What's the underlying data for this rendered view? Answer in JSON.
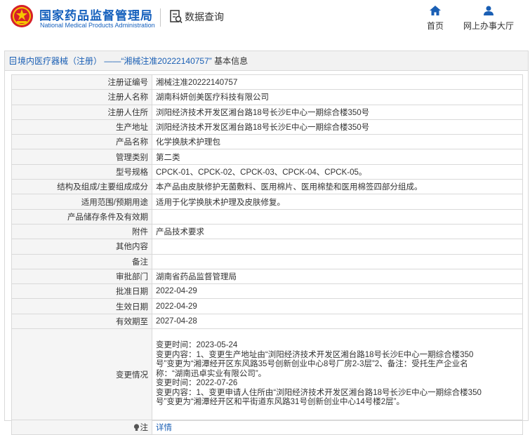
{
  "header": {
    "site_name": "国家药品监督管理局",
    "site_sub": "National Medical Products Administration",
    "query_label": "数据查询",
    "nav": [
      {
        "label": "首页",
        "icon": "home-icon"
      },
      {
        "label": "网上办事大厅",
        "icon": "user-icon"
      }
    ]
  },
  "panel": {
    "crumb_category": "境内医疗器械（注册）",
    "crumb_sep": "——",
    "crumb_record": "“湘械注准20222140757”",
    "crumb_tail": "基本信息"
  },
  "colors": {
    "brand": "#1560bd",
    "link": "#1a5fb4",
    "key_bg": "#f5f5f5",
    "border": "#d9d9d9"
  },
  "fields": {
    "reg_no": {
      "label": "注册证编号",
      "value": "湘械注准20222140757"
    },
    "registrant": {
      "label": "注册人名称",
      "value": "湖南科妍创美医疗科技有限公司"
    },
    "registrant_addr": {
      "label": "注册人住所",
      "value": "浏阳经济技术开发区湘台路18号长沙E中心一期综合楼350号"
    },
    "prod_addr": {
      "label": "生产地址",
      "value": "浏阳经济技术开发区湘台路18号长沙E中心一期综合楼350号"
    },
    "product_name": {
      "label": "产品名称",
      "value": "化学换肤术护理包"
    },
    "mgmt_class": {
      "label": "管理类别",
      "value": "第二类"
    },
    "model": {
      "label": "型号规格",
      "value": "CPCK-01、CPCK-02、CPCK-03、CPCK-04、CPCK-05。"
    },
    "structure": {
      "label": "结构及组成/主要组成成分",
      "value": "本产品由皮肤修护无菌敷料、医用棉片、医用棉垫和医用棉签四部分组成。"
    },
    "scope": {
      "label": "适用范围/预期用途",
      "value": "适用于化学换肤术护理及皮肤修复。"
    },
    "storage": {
      "label": "产品储存条件及有效期",
      "value": ""
    },
    "attachment": {
      "label": "附件",
      "value": "产品技术要求"
    },
    "other": {
      "label": "其他内容",
      "value": ""
    },
    "remark": {
      "label": "备注",
      "value": ""
    },
    "dept": {
      "label": "审批部门",
      "value": "湖南省药品监督管理局"
    },
    "approve_date": {
      "label": "批准日期",
      "value": "2022-04-29"
    },
    "effective_date": {
      "label": "生效日期",
      "value": "2022-04-29"
    },
    "expiry": {
      "label": "有效期至",
      "value": "2027-04-28"
    },
    "changes": {
      "label": "变更情况",
      "lines": [
        "变更时间：2023-05-24",
        "变更内容：1、变更生产地址由“浏阳经济技术开发区湘台路18号长沙E中心一期综合楼350",
        "号”变更为“湘潭经开区东风路35号创新创业中心8号厂房2-3层”2、备注：受托生产企业名",
        "称：“湖南迅卓实业有限公司”。",
        "变更时间：2022-07-26",
        "变更内容：1、变更申请人住所由“浏阳经济技术开发区湘台路18号长沙E中心一期综合楼350",
        "号”变更为“湘潭经开区和平街道东风路31号创新创业中心14号楼2层”。"
      ]
    },
    "note": {
      "label": "注",
      "link": "详情"
    }
  }
}
